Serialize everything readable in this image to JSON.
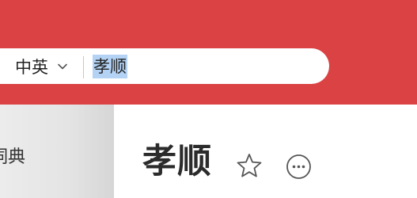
{
  "search": {
    "language_label": "中英",
    "query": "孝顺"
  },
  "sidebar": {
    "items": [
      {
        "label": "词典"
      }
    ]
  },
  "entry": {
    "word": "孝顺"
  },
  "icons": {
    "language_dropdown": "chevron-down-icon",
    "favorite": "star-icon",
    "more": "more-icon"
  },
  "colors": {
    "header_background": "#db4244",
    "selection_highlight": "#b3d2f4"
  }
}
